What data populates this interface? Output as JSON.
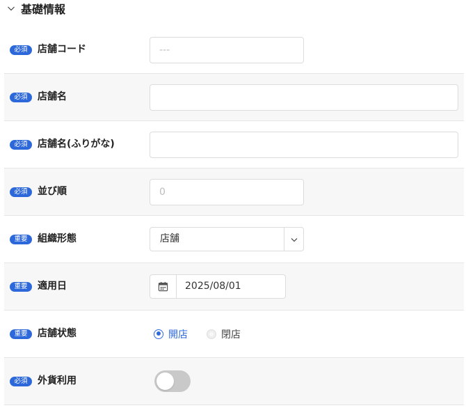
{
  "section": {
    "title": "基礎情報",
    "expanded": true
  },
  "colors": {
    "accent": "#2d68db",
    "row_alt": "#f7f7f7",
    "border": "#dcdcdc",
    "toggle_off": "#c9c9c9"
  },
  "icons": {
    "section_toggle": "chevron-down-icon",
    "select_arrow": "chevron-down-icon",
    "date_picker": "calendar-icon"
  },
  "fields": {
    "store_code": {
      "badge": "必須",
      "label": "店舗コード",
      "value": "",
      "placeholder": "---"
    },
    "store_name": {
      "badge": "必須",
      "label": "店舗名",
      "value": "",
      "placeholder": ""
    },
    "store_name_kana": {
      "badge": "必須",
      "label": "店舗名(ふりがな)",
      "value": "",
      "placeholder": ""
    },
    "sort_order": {
      "badge": "必須",
      "label": "並び順",
      "value": "",
      "placeholder": "0"
    },
    "org_type": {
      "badge": "重要",
      "label": "組織形態",
      "value": "店舗"
    },
    "effective_date": {
      "badge": "重要",
      "label": "適用日",
      "value": "2025/08/01"
    },
    "store_status": {
      "badge": "重要",
      "label": "店舗状態",
      "options": [
        {
          "label": "開店",
          "selected": true
        },
        {
          "label": "閉店",
          "selected": false
        }
      ]
    },
    "foreign_currency": {
      "badge": "必須",
      "label": "外貨利用",
      "value": false
    }
  }
}
